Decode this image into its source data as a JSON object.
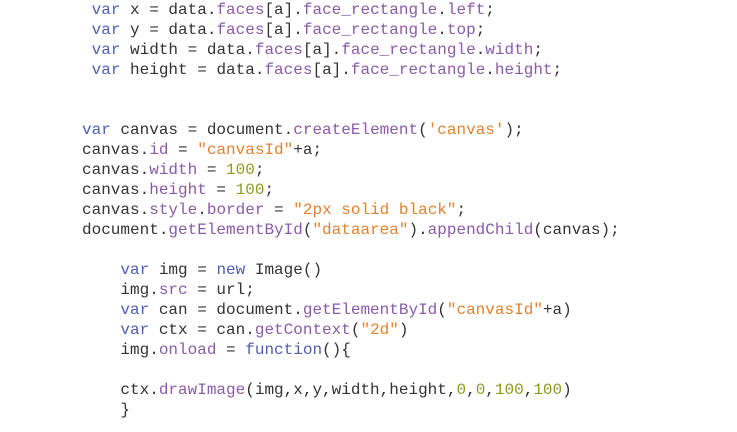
{
  "colors": {
    "keyword": "#4d5fb3",
    "property": "#8b5aa8",
    "string": "#e4802f",
    "number": "#8a9b1c",
    "text": "#333333"
  },
  "code_lines": [
    [
      [
        "txt",
        " "
      ],
      [
        "kw",
        "var"
      ],
      [
        "txt",
        " x = data."
      ],
      [
        "prop",
        "faces"
      ],
      [
        "txt",
        "[a]."
      ],
      [
        "prop",
        "face_rectangle"
      ],
      [
        "txt",
        "."
      ],
      [
        "prop",
        "left"
      ],
      [
        "txt",
        ";"
      ]
    ],
    [
      [
        "txt",
        " "
      ],
      [
        "kw",
        "var"
      ],
      [
        "txt",
        " y = data."
      ],
      [
        "prop",
        "faces"
      ],
      [
        "txt",
        "[a]."
      ],
      [
        "prop",
        "face_rectangle"
      ],
      [
        "txt",
        "."
      ],
      [
        "prop",
        "top"
      ],
      [
        "txt",
        ";"
      ]
    ],
    [
      [
        "txt",
        " "
      ],
      [
        "kw",
        "var"
      ],
      [
        "txt",
        " width = data."
      ],
      [
        "prop",
        "faces"
      ],
      [
        "txt",
        "[a]."
      ],
      [
        "prop",
        "face_rectangle"
      ],
      [
        "txt",
        "."
      ],
      [
        "prop",
        "width"
      ],
      [
        "txt",
        ";"
      ]
    ],
    [
      [
        "txt",
        " "
      ],
      [
        "kw",
        "var"
      ],
      [
        "txt",
        " height = data."
      ],
      [
        "prop",
        "faces"
      ],
      [
        "txt",
        "[a]."
      ],
      [
        "prop",
        "face_rectangle"
      ],
      [
        "txt",
        "."
      ],
      [
        "prop",
        "height"
      ],
      [
        "txt",
        ";"
      ]
    ],
    [],
    [],
    [
      [
        "kw",
        "var"
      ],
      [
        "txt",
        " canvas = document."
      ],
      [
        "prop",
        "createElement"
      ],
      [
        "txt",
        "("
      ],
      [
        "str",
        "'canvas'"
      ],
      [
        "txt",
        ");"
      ]
    ],
    [
      [
        "txt",
        "canvas."
      ],
      [
        "prop",
        "id"
      ],
      [
        "txt",
        " = "
      ],
      [
        "str",
        "\"canvasId\""
      ],
      [
        "txt",
        "+a;"
      ]
    ],
    [
      [
        "txt",
        "canvas."
      ],
      [
        "prop",
        "width"
      ],
      [
        "txt",
        " = "
      ],
      [
        "num",
        "100"
      ],
      [
        "txt",
        ";"
      ]
    ],
    [
      [
        "txt",
        "canvas."
      ],
      [
        "prop",
        "height"
      ],
      [
        "txt",
        " = "
      ],
      [
        "num",
        "100"
      ],
      [
        "txt",
        ";"
      ]
    ],
    [
      [
        "txt",
        "canvas."
      ],
      [
        "prop",
        "style"
      ],
      [
        "txt",
        "."
      ],
      [
        "prop",
        "border"
      ],
      [
        "txt",
        " = "
      ],
      [
        "str",
        "\"2px solid black\""
      ],
      [
        "txt",
        ";"
      ]
    ],
    [
      [
        "txt",
        "document."
      ],
      [
        "prop",
        "getElementById"
      ],
      [
        "txt",
        "("
      ],
      [
        "str",
        "\"dataarea\""
      ],
      [
        "txt",
        "). "
      ],
      [
        "prop",
        "appendChild"
      ],
      [
        "txt",
        "(canvas);"
      ]
    ],
    [],
    [
      [
        "txt",
        "    "
      ],
      [
        "kw",
        "var"
      ],
      [
        "txt",
        " img = "
      ],
      [
        "kw",
        "new"
      ],
      [
        "txt",
        " Image()"
      ]
    ],
    [
      [
        "txt",
        "    img."
      ],
      [
        "prop",
        "src"
      ],
      [
        "txt",
        " = url;"
      ]
    ],
    [
      [
        "txt",
        "    "
      ],
      [
        "kw",
        "var"
      ],
      [
        "txt",
        " can = document."
      ],
      [
        "prop",
        "getElementById"
      ],
      [
        "txt",
        "("
      ],
      [
        "str",
        "\"canvasId\""
      ],
      [
        "txt",
        "+a)"
      ]
    ],
    [
      [
        "txt",
        "    "
      ],
      [
        "kw",
        "var"
      ],
      [
        "txt",
        " ctx = can."
      ],
      [
        "prop",
        "getContext"
      ],
      [
        "txt",
        "("
      ],
      [
        "str",
        "\"2d\""
      ],
      [
        "txt",
        ")"
      ]
    ],
    [
      [
        "txt",
        "    img."
      ],
      [
        "prop",
        "onload"
      ],
      [
        "txt",
        " = "
      ],
      [
        "kw",
        "function"
      ],
      [
        "txt",
        "(){"
      ]
    ],
    [],
    [
      [
        "txt",
        "    ctx."
      ],
      [
        "prop",
        "drawImage"
      ],
      [
        "txt",
        "(img,x,y,width,height,"
      ],
      [
        "num",
        "0"
      ],
      [
        "txt",
        ","
      ],
      [
        "num",
        "0"
      ],
      [
        "txt",
        ","
      ],
      [
        "num",
        "100"
      ],
      [
        "txt",
        ","
      ],
      [
        "num",
        "100"
      ],
      [
        "txt",
        ")"
      ]
    ],
    [
      [
        "txt",
        "    }"
      ]
    ]
  ]
}
